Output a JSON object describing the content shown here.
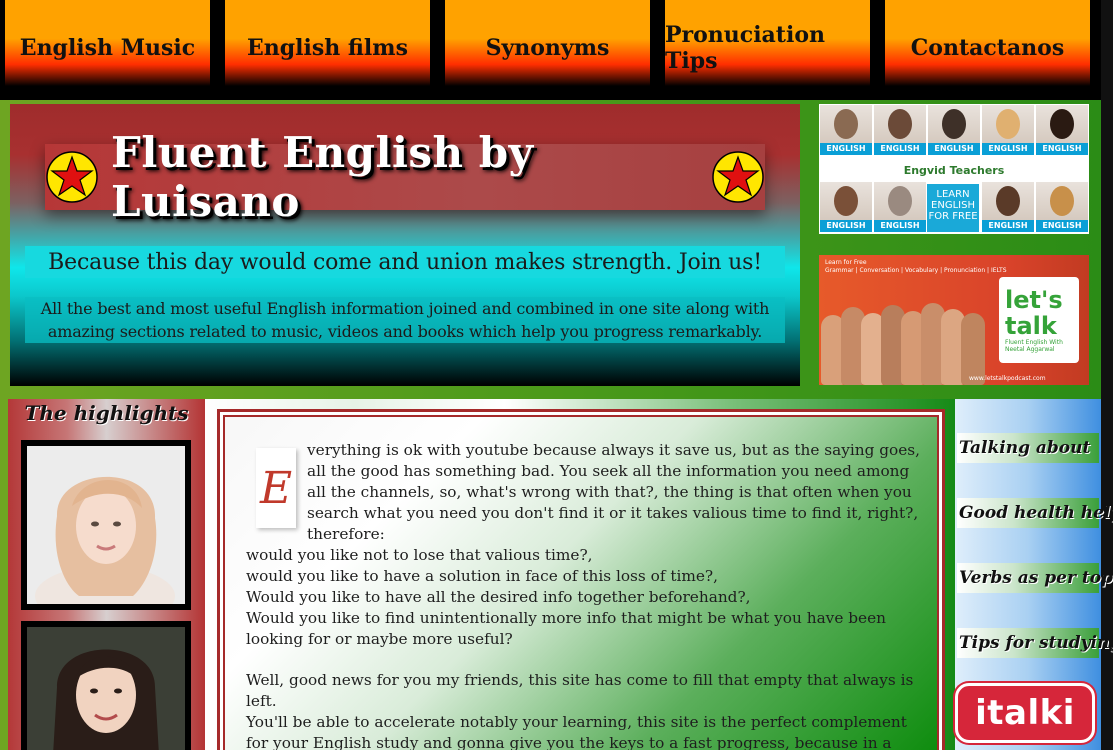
{
  "nav": {
    "items": [
      {
        "label": "English Music"
      },
      {
        "label": "English films"
      },
      {
        "label": "Synonyms"
      },
      {
        "label": "Pronuciation Tips"
      },
      {
        "label": "Contactanos"
      }
    ]
  },
  "header": {
    "title": "Fluent English by Luisano",
    "slogan": "Because this day would come and union makes strength. Join us!",
    "description": "All the best and most useful English information joined and combined in one site along with amazing sections related to music, videos and books which help you progress remarkably."
  },
  "ads": {
    "teachers": {
      "tag": "ENGLISH",
      "caption": "Engvid Teachers",
      "learn_box": "LEARN ENGLISH FOR FREE"
    },
    "letstalk": {
      "top_text": "Learn for Free",
      "top_sub": "Grammar | Conversation | Vocabulary | Pronunciation | IELTS",
      "logo": "let's talk",
      "logo_sub": "Fluent English With Neetal Aggarwal",
      "url": "www.letstalkpodcast.com"
    }
  },
  "left_sidebar": {
    "title": "The highlights"
  },
  "article": {
    "dropcap": "E",
    "first_paragraph": "verything is ok with youtube because always it save us, but as the saying goes, all the good has something bad. You seek all the information you need among all the channels, so, what's wrong with that?, the thing is that often when you search what you need you don't find it or it takes valious time to find it, right?, therefore:",
    "lines": [
      "would you like not to lose that valious time?,",
      "would you like to have a solution in face of this loss of time?,",
      "Would you like to have all the desired info together beforehand?,",
      "Would you like to find unintentionally more info that might be what you have been looking for or maybe more useful?"
    ],
    "para2": "Well, good news for you my friends, this site has come to fill that empty that always is left.",
    "para3": "You'll be able to accelerate notably your learning, this site is the perfect complement for your English study and gonna give you the keys to a fast progress, because in a near"
  },
  "right_sidebar": {
    "links": [
      {
        "label": "Talking about"
      },
      {
        "label": "Good health helps"
      },
      {
        "label": "Verbs as per topic"
      },
      {
        "label": "Tips for studying"
      }
    ],
    "italki_label": "italki"
  },
  "colors": {
    "nav_orange": "#ffa200",
    "nav_red": "#ff2e00",
    "banner_red": "#a83030",
    "banner_cyan": "#17d9df",
    "article_border": "#a52a2a",
    "italki_red": "#d6263a"
  }
}
